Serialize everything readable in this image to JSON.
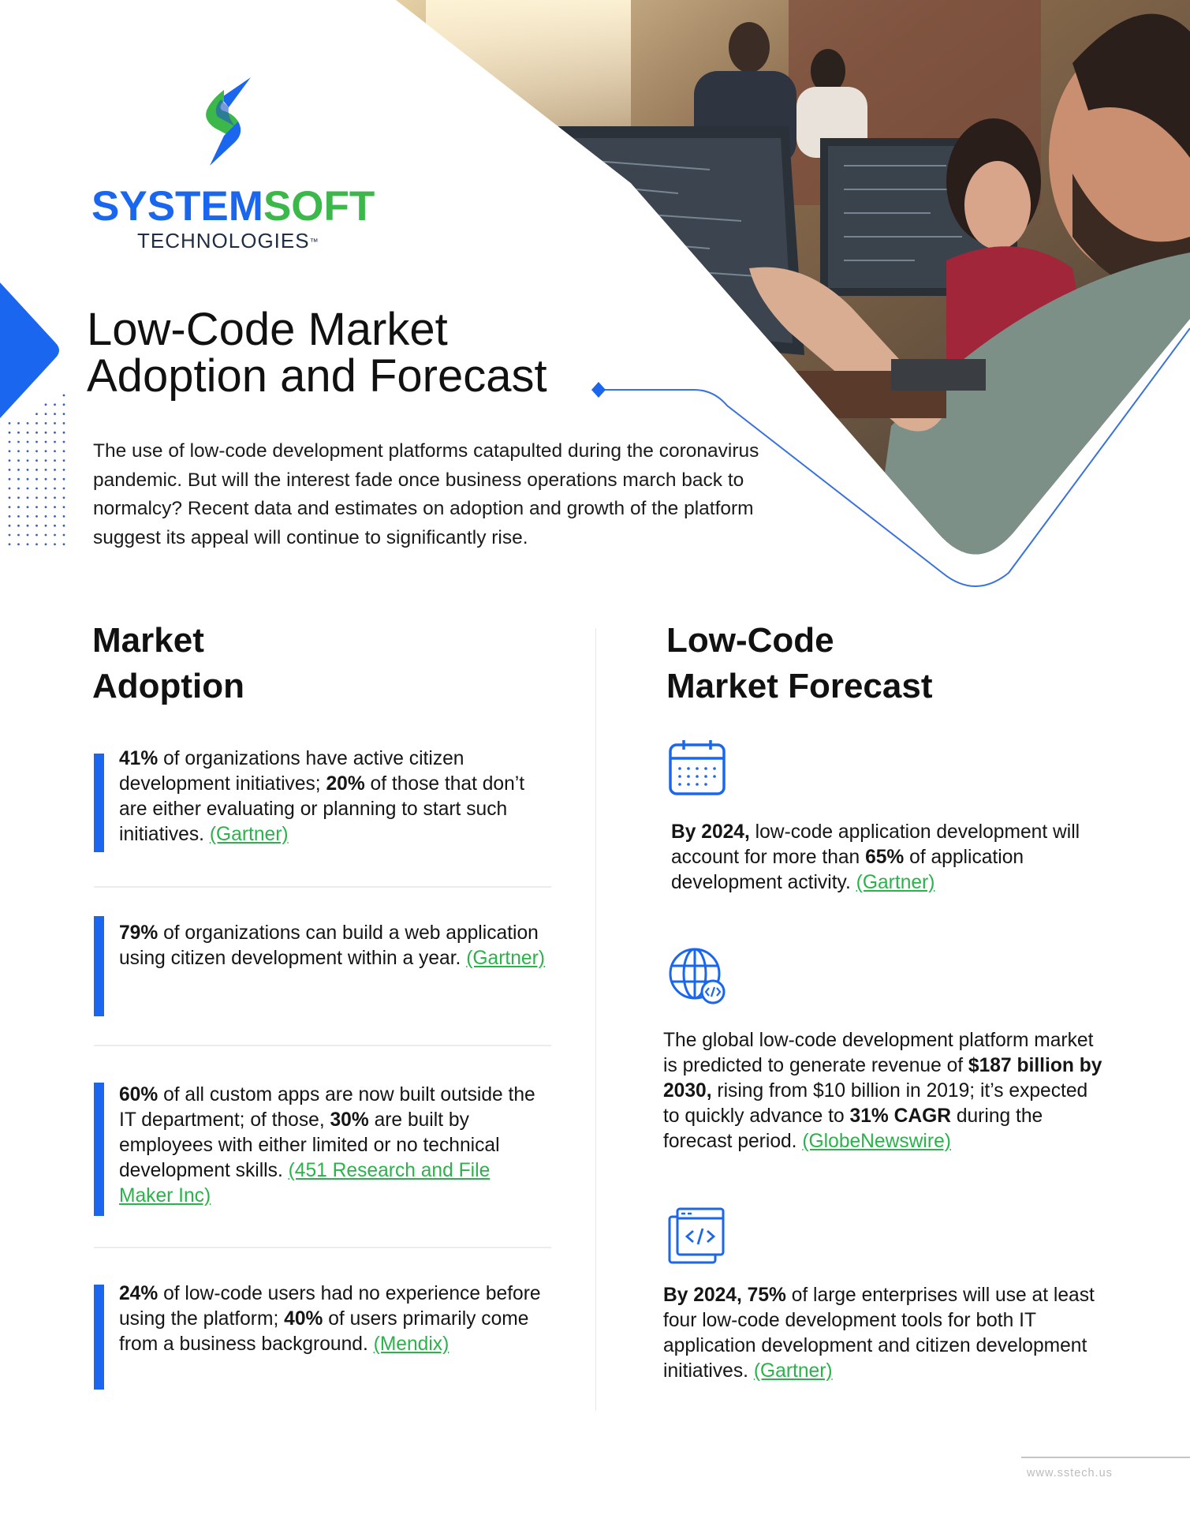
{
  "brand": {
    "name_part1": "SYSTEM",
    "name_part2": "SOFT",
    "subtitle": "TECHNOLOGIES",
    "trademark": "™",
    "colors": {
      "blue": "#1a66ee",
      "green": "#3cb84a",
      "navy": "#1f2d45"
    }
  },
  "hero": {
    "title_line1": "Low-Code Market",
    "title_line2": "Adoption and Forecast",
    "photo_alt": "Developers working at computers with code on screens",
    "intro": "The use of low-code development platforms catapulted during the coronavirus pandemic. But will the interest fade once business operations march back to normalcy? Recent data and estimates on adoption and growth of the platform suggest its appeal will continue to significantly rise."
  },
  "adoption": {
    "heading_line1": "Market",
    "heading_line2": "Adoption",
    "items": [
      {
        "segments": [
          {
            "b": "41%"
          },
          {
            "t": " of organizations have active citizen development initiatives; "
          },
          {
            "b": "20%"
          },
          {
            "t": " of those that don’t are either evaluating or planning to start such initiatives. "
          }
        ],
        "source": "(Gartner)"
      },
      {
        "segments": [
          {
            "b": "79%"
          },
          {
            "t": " of organizations can build a web application using citizen development within a year. "
          }
        ],
        "source": "(Gartner)"
      },
      {
        "segments": [
          {
            "b": "60%"
          },
          {
            "t": " of all custom apps are now built outside the IT department; of those, "
          },
          {
            "b": "30%"
          },
          {
            "t": " are built by employees with either limited or no technical development skills. "
          }
        ],
        "source": "(451 Research and File Maker Inc)"
      },
      {
        "segments": [
          {
            "b": "24%"
          },
          {
            "t": " of low-code users had no experience before using the platform; "
          },
          {
            "b": "40%"
          },
          {
            "t": " of users primarily come from a business background. "
          }
        ],
        "source": "(Mendix)"
      }
    ]
  },
  "forecast": {
    "heading_line1": "Low-Code",
    "heading_line2": "Market Forecast",
    "items": [
      {
        "icon": "calendar-icon",
        "segments": [
          {
            "b": "By 2024,"
          },
          {
            "t": " low-code application development will account for more than "
          },
          {
            "b": "65%"
          },
          {
            "t": " of application development activity. "
          }
        ],
        "source": "(Gartner)"
      },
      {
        "icon": "globe-code-icon",
        "segments": [
          {
            "t": "The global low-code development platform market is predicted to generate revenue of "
          },
          {
            "b": "$187 billion by 2030,"
          },
          {
            "t": " rising from $10 billion in 2019; it’s expected to quickly advance to "
          },
          {
            "b": "31% CAGR"
          },
          {
            "t": " during the forecast period. "
          }
        ],
        "source": "(GlobeNewswire)"
      },
      {
        "icon": "code-window-icon",
        "segments": [
          {
            "b": "By 2024, 75%"
          },
          {
            "t": " of large enterprises will use at least four low-code development tools for both IT application development and citizen development initiatives. "
          }
        ],
        "source": "(Gartner)"
      }
    ]
  },
  "footer": {
    "url": "www.sstech.us"
  }
}
